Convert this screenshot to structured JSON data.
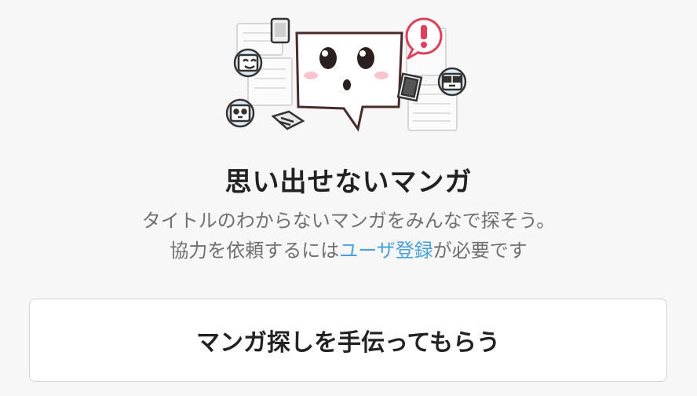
{
  "empty_state": {
    "title": "思い出せないマンガ",
    "description_line1": "タイトルのわからないマンガをみんなで探そう。",
    "description_line2_prefix": "協力を依頼するには",
    "register_link": "ユーザ登録",
    "description_line2_suffix": "が必要です",
    "cta_label": "マンガ探しを手伝ってもらう"
  },
  "illustration": {
    "exclamation": "!",
    "accent_color": "#e0405a",
    "outline_color": "#333333"
  },
  "colors": {
    "background": "#f7f7f7",
    "link": "#4aa0dc",
    "text": "#222222",
    "muted_text": "#707070"
  }
}
